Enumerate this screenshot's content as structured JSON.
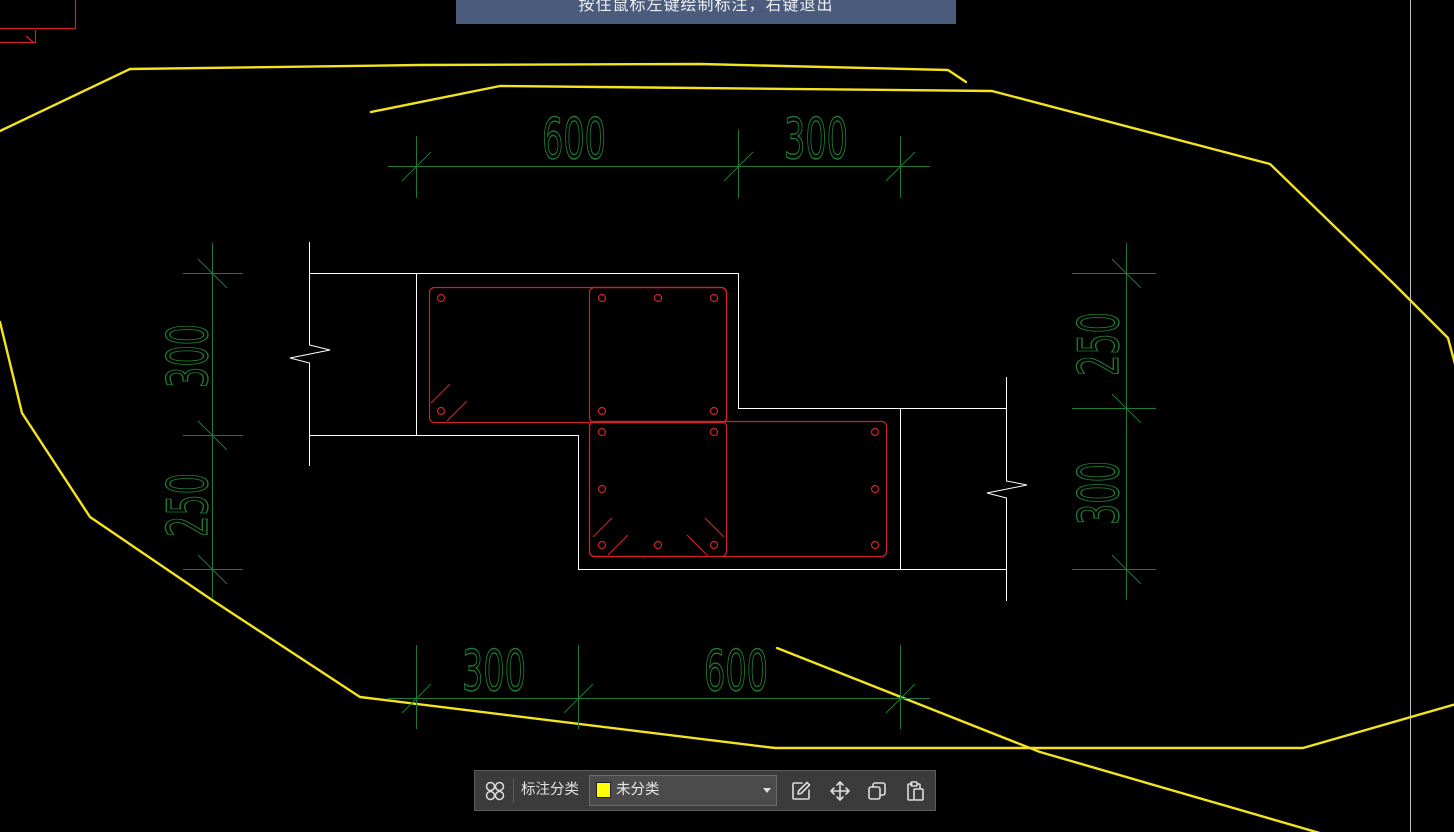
{
  "banner": {
    "message": "按住鼠标左键绘制标注，右键退出"
  },
  "dimensions": {
    "top": [
      "600",
      "300"
    ],
    "bottom": [
      "300",
      "600"
    ],
    "left": [
      "300",
      "250"
    ],
    "right": [
      "250",
      "300"
    ]
  },
  "toolbar": {
    "category_label": "标注分类",
    "category_value": "未分类",
    "category_color": "#ffff00",
    "icons": [
      "grid-circles-icon",
      "edit-annotation-icon",
      "move-icon",
      "copy-icon",
      "paste-icon"
    ]
  },
  "colors": {
    "canvas_background": "#000000",
    "dimension_lines": "#1e7a33",
    "rebar": "#d0202a",
    "outline": "#ffffff",
    "sketch": "#f3e41f",
    "banner": "#4b5b7b",
    "toolbar": "#3b3b3b"
  }
}
